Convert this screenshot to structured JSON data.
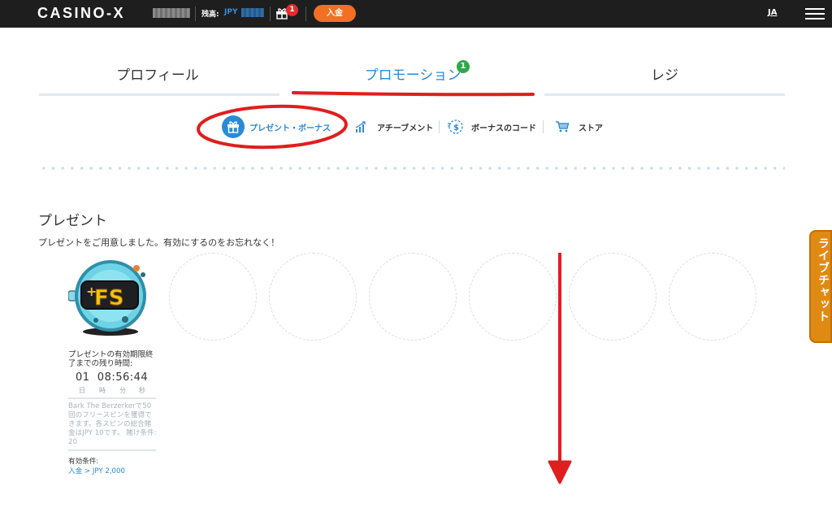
{
  "topbar": {
    "logo": "CASINO-X",
    "balance_label": "残高:",
    "balance_currency": "JPY",
    "gift_badge_count": "1",
    "deposit_label": "入金",
    "language": "JA"
  },
  "tabs": [
    {
      "label": "プロフィール",
      "active": false
    },
    {
      "label": "プロモーション",
      "active": true,
      "badge": "1"
    },
    {
      "label": "レジ",
      "active": false
    }
  ],
  "subtabs": [
    {
      "label": "プレゼント・ボーナス",
      "icon": "gift-icon",
      "active": true
    },
    {
      "label": "アチーブメント",
      "icon": "chart-icon",
      "active": false
    },
    {
      "label": "ボーナスのコード",
      "icon": "bonus-code-icon",
      "active": false
    },
    {
      "label": "ストア",
      "icon": "cart-icon",
      "active": false
    }
  ],
  "present": {
    "title": "プレゼント",
    "description": "プレゼントをご用意しました。有効にするのをお忘れなく！",
    "card": {
      "icon": "free-spins-icon",
      "icon_text": "FS",
      "expiry_label": "プレゼントの有効期限終了までの残り時間:",
      "timer": "01  08:56:44",
      "units": [
        "日",
        "時",
        "分",
        "秒"
      ],
      "detail": "Bark The Berzerkerで50回のフリースピンを獲得できます。各スピンの総合賭金はJPY 10です。 賭け条件: 20",
      "condition_title": "有効条件:",
      "condition_link": "入金 > JPY 2,000"
    }
  },
  "live_chat_label": "ライブチャット",
  "colors": {
    "accent": "#2b8ad3",
    "deposit": "#f36f21",
    "badge_red": "#e22c2c",
    "badge_green": "#2ea84a",
    "live_chat": "#e08a14",
    "annotation": "#e01e1e"
  }
}
